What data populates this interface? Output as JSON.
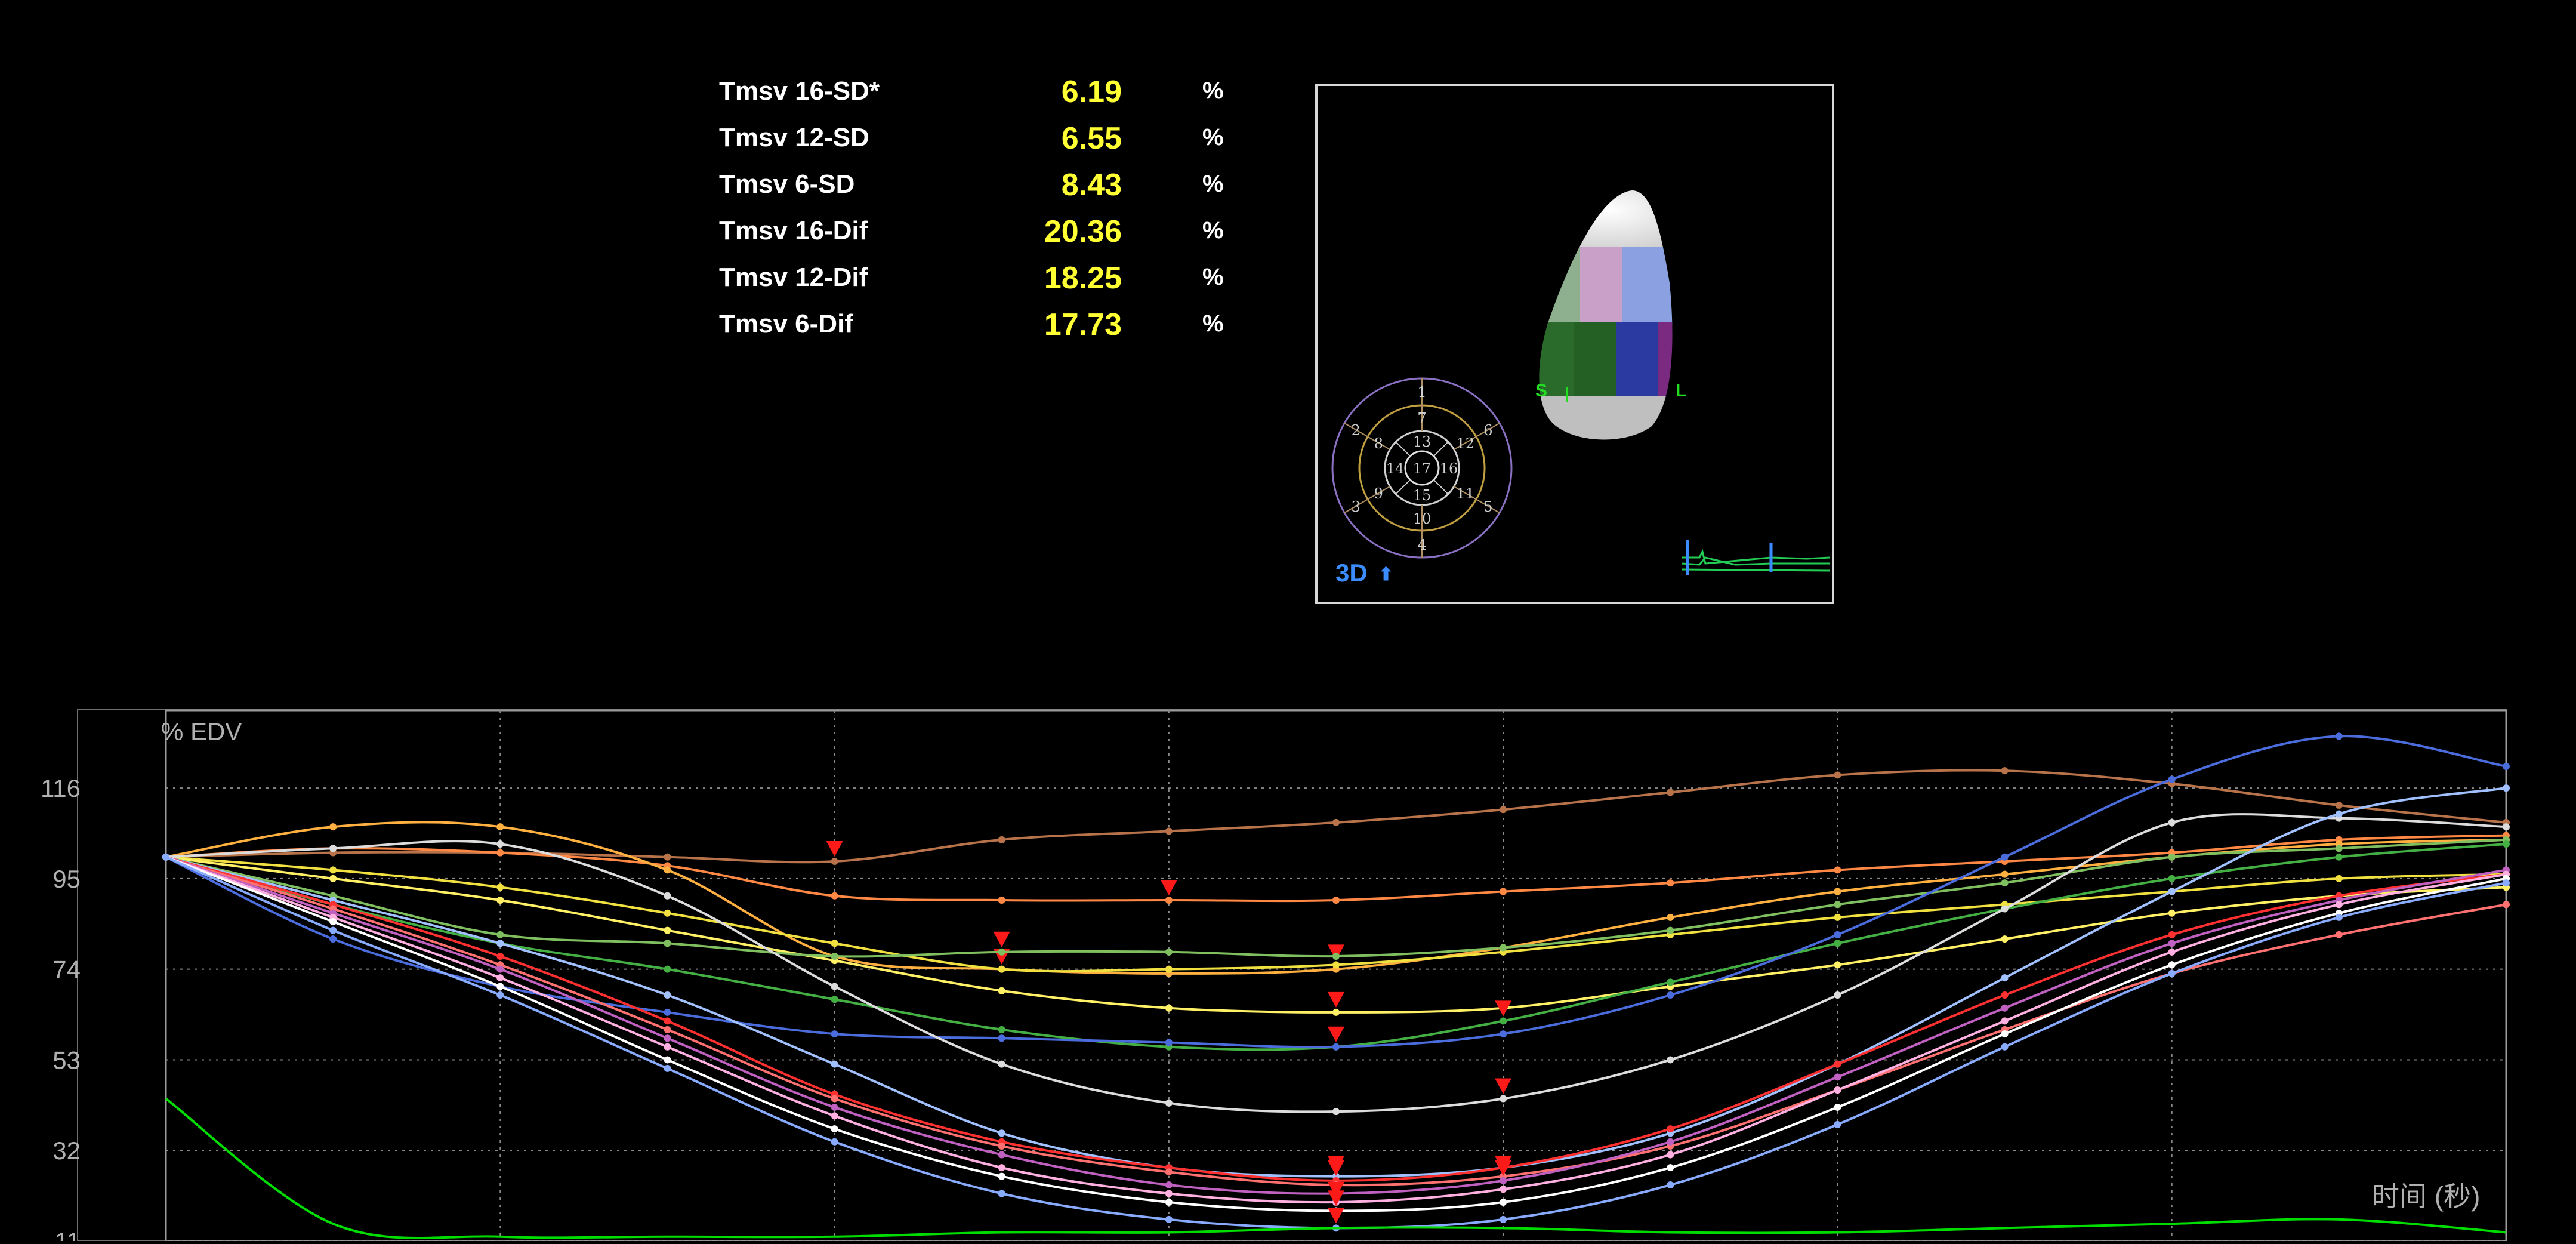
{
  "stats": [
    {
      "label": "Tmsv 16-SD*",
      "value": "6.19",
      "unit": "%"
    },
    {
      "label": "Tmsv 12-SD",
      "value": "6.55",
      "unit": "%"
    },
    {
      "label": "Tmsv 6-SD",
      "value": "8.43",
      "unit": "%"
    },
    {
      "label": "Tmsv 16-Dif",
      "value": "20.36",
      "unit": "%"
    },
    {
      "label": "Tmsv 12-Dif",
      "value": "18.25",
      "unit": "%"
    },
    {
      "label": "Tmsv 6-Dif",
      "value": "17.73",
      "unit": "%"
    }
  ],
  "thumbnail": {
    "view_label": "3D",
    "orientation_left": "S",
    "orientation_right": "L",
    "bullseye_segments": [
      "1",
      "2",
      "3",
      "4",
      "5",
      "6",
      "7",
      "8",
      "9",
      "10",
      "11",
      "12",
      "13",
      "14",
      "15",
      "16",
      "17"
    ]
  },
  "colors": {
    "accent_value": "#ffff33",
    "marker": "#ff1a1a",
    "grid": "#8a8a8a",
    "view_label": "#3a8cff"
  },
  "chart_data": {
    "type": "line",
    "ylabel": "% EDV",
    "xlabel": "时间 (秒)",
    "yticks": [
      11,
      32,
      53,
      74,
      95,
      116
    ],
    "ylim": [
      11,
      134
    ],
    "xlim": [
      0,
      28
    ],
    "x": [
      0,
      2,
      4,
      6,
      8,
      10,
      12,
      14,
      16,
      18,
      20,
      22,
      24,
      26,
      28
    ],
    "series": [
      {
        "color": "#b8734a",
        "values": [
          100,
          101,
          101,
          100,
          99,
          104,
          106,
          108,
          111,
          115,
          119,
          120,
          117,
          112,
          108
        ],
        "min_index": 4
      },
      {
        "color": "#ff8844",
        "values": [
          100,
          102,
          101,
          98,
          91,
          90,
          90,
          90,
          92,
          94,
          97,
          99,
          101,
          104,
          105
        ],
        "min_index": 6
      },
      {
        "color": "#ffb040",
        "values": [
          100,
          107,
          107,
          97,
          77,
          74,
          73,
          74,
          79,
          86,
          92,
          96,
          100,
          103,
          104
        ],
        "min_index": 5
      },
      {
        "color": "#f0e040",
        "values": [
          100,
          97,
          93,
          87,
          80,
          74,
          74,
          75,
          78,
          82,
          86,
          89,
          92,
          95,
          96
        ],
        "min_index": 7
      },
      {
        "color": "#fff066",
        "values": [
          100,
          95,
          90,
          83,
          76,
          69,
          65,
          64,
          65,
          70,
          75,
          81,
          87,
          91,
          93
        ],
        "min_index": 7
      },
      {
        "color": "#7fbf60",
        "values": [
          100,
          91,
          82,
          80,
          77,
          78,
          78,
          77,
          79,
          83,
          89,
          94,
          100,
          102,
          104
        ],
        "min_index": 5
      },
      {
        "color": "#44b044",
        "values": [
          100,
          89,
          80,
          74,
          67,
          60,
          56,
          56,
          62,
          71,
          80,
          88,
          95,
          100,
          103
        ],
        "min_index": 8
      },
      {
        "color": "#4a6cdc",
        "values": [
          100,
          81,
          70,
          64,
          59,
          58,
          57,
          56,
          59,
          68,
          82,
          100,
          118,
          128,
          121
        ],
        "min_index": 7
      },
      {
        "color": "#dcdcdc",
        "values": [
          100,
          102,
          103,
          91,
          70,
          52,
          43,
          41,
          44,
          53,
          68,
          88,
          108,
          109,
          107
        ],
        "min_index": 8
      },
      {
        "color": "#a0c0ff",
        "values": [
          100,
          90,
          80,
          68,
          52,
          36,
          28,
          26,
          28,
          36,
          52,
          72,
          92,
          110,
          116
        ],
        "min_index": 7
      },
      {
        "color": "#ff3030",
        "values": [
          100,
          89,
          77,
          62,
          45,
          34,
          28,
          25,
          28,
          37,
          52,
          68,
          82,
          91,
          96
        ],
        "min_index": 7
      },
      {
        "color": "#ff7070",
        "values": [
          100,
          88,
          75,
          60,
          44,
          33,
          27,
          24,
          26,
          33,
          46,
          60,
          73,
          82,
          89
        ],
        "min_index": 8
      },
      {
        "color": "#c060c0",
        "values": [
          100,
          87,
          74,
          58,
          42,
          31,
          24,
          22,
          25,
          34,
          49,
          65,
          80,
          90,
          97
        ],
        "min_index": 8
      },
      {
        "color": "#ffb0e0",
        "values": [
          100,
          86,
          72,
          56,
          40,
          28,
          22,
          20,
          23,
          31,
          46,
          62,
          78,
          89,
          96
        ],
        "min_index": 7
      },
      {
        "color": "#ffffff",
        "values": [
          100,
          85,
          70,
          53,
          37,
          26,
          20,
          18,
          20,
          28,
          42,
          59,
          75,
          87,
          95
        ],
        "min_index": 7
      },
      {
        "color": "#88aaff",
        "values": [
          100,
          83,
          68,
          51,
          34,
          22,
          16,
          14,
          16,
          24,
          38,
          56,
          73,
          86,
          94
        ],
        "min_index": 7
      },
      {
        "color": "#00dd00",
        "values": [
          44,
          15,
          12,
          12,
          12,
          13,
          13,
          14,
          14,
          13,
          13,
          14,
          15,
          16,
          13
        ],
        "min_index": null
      }
    ]
  }
}
